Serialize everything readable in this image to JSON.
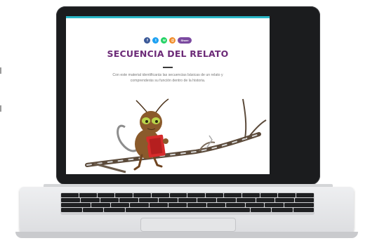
{
  "page": {
    "title": "SECUENCIA DEL RELATO",
    "description": "Con este material identificarás las secuencias básicas de un relato y comprenderás su función dentro de la historia."
  },
  "share": {
    "buttons": [
      {
        "icon": "facebook-icon",
        "glyph": "f",
        "color": "#3b5998"
      },
      {
        "icon": "twitter-icon",
        "glyph": "t",
        "color": "#1da1f2"
      },
      {
        "icon": "whatsapp-icon",
        "glyph": "w",
        "color": "#25d366"
      },
      {
        "icon": "email-icon",
        "glyph": "@",
        "color": "#f08a24"
      }
    ],
    "pill_label": "Share"
  },
  "colors": {
    "title": "#6d2b78",
    "accent_bar": "#2ab7c7",
    "laptop_bezel": "#1b1c1e",
    "book": "#d62b2b",
    "ant_body": "#8a5a2b",
    "ant_eyes": "#b9d44a"
  },
  "illustration": {
    "subject": "ant reading a red book on a tree branch",
    "icon": "ant-reading-illustration"
  }
}
